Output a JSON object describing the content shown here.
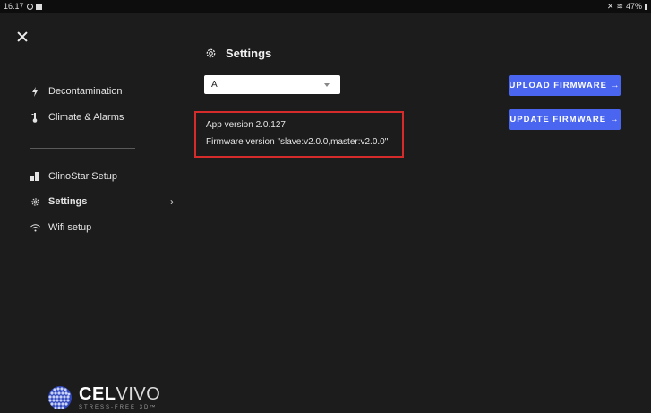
{
  "status_bar": {
    "time": "16.17",
    "battery": "47%"
  },
  "sidebar": {
    "items": [
      {
        "label": "Decontamination",
        "icon": "lightning-icon"
      },
      {
        "label": "Climate & Alarms",
        "icon": "thermometer-icon"
      },
      {
        "label": "ClinoStar Setup",
        "icon": "setup-icon"
      },
      {
        "label": "Settings",
        "icon": "gear-icon",
        "active": true
      },
      {
        "label": "Wifi setup",
        "icon": "wifi-icon"
      }
    ],
    "active_chevron": "›"
  },
  "header": {
    "title": "Settings"
  },
  "device_select": {
    "value": "A"
  },
  "version_info": {
    "app_version": "App version 2.0.127",
    "firmware_version": "Firmware version \"slave:v2.0.0,master:v2.0.0\""
  },
  "actions": {
    "upload_firmware": "UPLOAD FIRMWARE",
    "update_firmware": "UPDATE FIRMWARE",
    "arrow": "→"
  },
  "logo": {
    "brand_bold": "CEL",
    "brand_thin": "VIVO",
    "tagline": "STRESS-FREE 3D™"
  },
  "colors": {
    "accent": "#4a66f1",
    "highlight_border": "#d52b2b",
    "background": "#1c1c1c"
  }
}
